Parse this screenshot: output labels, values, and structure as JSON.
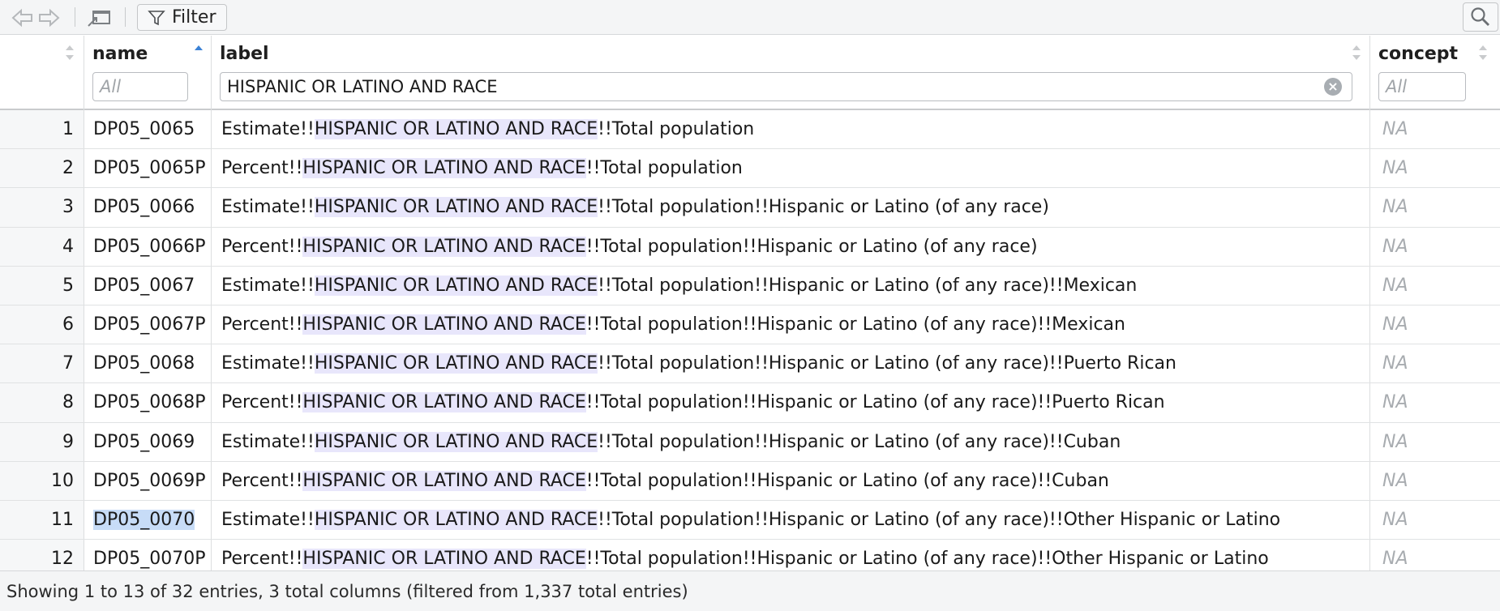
{
  "toolbar": {
    "back_icon": "arrow-left-icon",
    "forward_icon": "arrow-right-icon",
    "popout_icon": "popout-window-icon",
    "filter_label": "Filter",
    "filter_icon": "funnel-icon",
    "search_icon": "magnifier-icon"
  },
  "columns": {
    "name": {
      "title": "name",
      "filter_value": "",
      "filter_placeholder": "All",
      "sort": "ascending"
    },
    "label": {
      "title": "label",
      "filter_value": "HISPANIC OR LATINO AND RACE",
      "filter_placeholder": ""
    },
    "concept": {
      "title": "concept",
      "filter_value": "",
      "filter_placeholder": "All"
    }
  },
  "highlight_term": "HISPANIC OR LATINO AND RACE",
  "rows": [
    {
      "num": "1",
      "name": "DP05_0065",
      "label_prefix": "Estimate!!",
      "label_suffix": "!!Total population",
      "concept": "NA"
    },
    {
      "num": "2",
      "name": "DP05_0065P",
      "label_prefix": "Percent!!",
      "label_suffix": "!!Total population",
      "concept": "NA"
    },
    {
      "num": "3",
      "name": "DP05_0066",
      "label_prefix": "Estimate!!",
      "label_suffix": "!!Total population!!Hispanic or Latino (of any race)",
      "concept": "NA"
    },
    {
      "num": "4",
      "name": "DP05_0066P",
      "label_prefix": "Percent!!",
      "label_suffix": "!!Total population!!Hispanic or Latino (of any race)",
      "concept": "NA"
    },
    {
      "num": "5",
      "name": "DP05_0067",
      "label_prefix": "Estimate!!",
      "label_suffix": "!!Total population!!Hispanic or Latino (of any race)!!Mexican",
      "concept": "NA"
    },
    {
      "num": "6",
      "name": "DP05_0067P",
      "label_prefix": "Percent!!",
      "label_suffix": "!!Total population!!Hispanic or Latino (of any race)!!Mexican",
      "concept": "NA"
    },
    {
      "num": "7",
      "name": "DP05_0068",
      "label_prefix": "Estimate!!",
      "label_suffix": "!!Total population!!Hispanic or Latino (of any race)!!Puerto Rican",
      "concept": "NA"
    },
    {
      "num": "8",
      "name": "DP05_0068P",
      "label_prefix": "Percent!!",
      "label_suffix": "!!Total population!!Hispanic or Latino (of any race)!!Puerto Rican",
      "concept": "NA"
    },
    {
      "num": "9",
      "name": "DP05_0069",
      "label_prefix": "Estimate!!",
      "label_suffix": "!!Total population!!Hispanic or Latino (of any race)!!Cuban",
      "concept": "NA"
    },
    {
      "num": "10",
      "name": "DP05_0069P",
      "label_prefix": "Percent!!",
      "label_suffix": "!!Total population!!Hispanic or Latino (of any race)!!Cuban",
      "concept": "NA"
    },
    {
      "num": "11",
      "name": "DP05_0070",
      "label_prefix": "Estimate!!",
      "label_suffix": "!!Total population!!Hispanic or Latino (of any race)!!Other Hispanic or Latino",
      "concept": "NA",
      "selected": true
    },
    {
      "num": "12",
      "name": "DP05_0070P",
      "label_prefix": "Percent!!",
      "label_suffix": "!!Total population!!Hispanic or Latino (of any race)!!Other Hispanic or Latino",
      "concept": "NA"
    }
  ],
  "footer": {
    "status": "Showing 1 to 13 of 32 entries, 3 total columns (filtered from 1,337 total entries)"
  },
  "colors": {
    "highlight": "#e8e6fb",
    "selection": "#c7dcf7",
    "sort_active": "#3b82d6"
  }
}
